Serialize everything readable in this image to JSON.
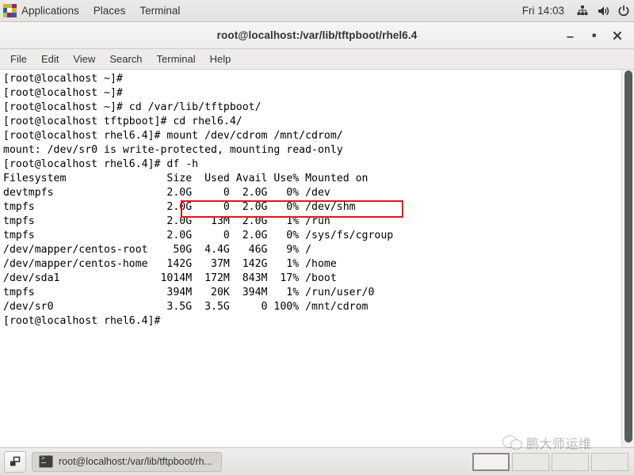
{
  "top_panel": {
    "apps_label": "Applications",
    "places_label": "Places",
    "terminal_label": "Terminal",
    "clock": "Fri 14:03",
    "icons": [
      "network-icon",
      "volume-icon",
      "power-icon"
    ],
    "logo_name": "centos-pinwheel-logo"
  },
  "window": {
    "title": "root@localhost:/var/lib/tftpboot/rhel6.4",
    "minimize_label": "–",
    "maximize_label": "▫",
    "close_label": "✕"
  },
  "menubar": {
    "items": [
      {
        "label": "File"
      },
      {
        "label": "Edit"
      },
      {
        "label": "View"
      },
      {
        "label": "Search"
      },
      {
        "label": "Terminal"
      },
      {
        "label": "Help"
      }
    ]
  },
  "terminal": {
    "lines": [
      "[root@localhost ~]#",
      "[root@localhost ~]#",
      "[root@localhost ~]# cd /var/lib/tftpboot/",
      "[root@localhost tftpboot]# cd rhel6.4/",
      "[root@localhost rhel6.4]# mount /dev/cdrom /mnt/cdrom/",
      "mount: /dev/sr0 is write-protected, mounting read-only",
      "[root@localhost rhel6.4]# df -h",
      "Filesystem                Size  Used Avail Use% Mounted on",
      "devtmpfs                  2.0G     0  2.0G   0% /dev",
      "tmpfs                     2.0G     0  2.0G   0% /dev/shm",
      "tmpfs                     2.0G   13M  2.0G   1% /run",
      "tmpfs                     2.0G     0  2.0G   0% /sys/fs/cgroup",
      "/dev/mapper/centos-root    50G  4.4G   46G   9% /",
      "/dev/mapper/centos-home   142G   37M  142G   1% /home",
      "/dev/sda1                1014M  172M  843M  17% /boot",
      "tmpfs                     394M   20K  394M   1% /run/user/0",
      "/dev/sr0                  3.5G  3.5G     0 100% /mnt/cdrom",
      "[root@localhost rhel6.4]#"
    ],
    "text": "[root@localhost ~]#\n[root@localhost ~]#\n[root@localhost ~]# cd /var/lib/tftpboot/\n[root@localhost tftpboot]# cd rhel6.4/\n[root@localhost rhel6.4]# mount /dev/cdrom /mnt/cdrom/\nmount: /dev/sr0 is write-protected, mounting read-only\n[root@localhost rhel6.4]# df -h\nFilesystem                Size  Used Avail Use% Mounted on\ndevtmpfs                  2.0G     0  2.0G   0% /dev\ntmpfs                     2.0G     0  2.0G   0% /dev/shm\ntmpfs                     2.0G   13M  2.0G   1% /run\ntmpfs                     2.0G     0  2.0G   0% /sys/fs/cgroup\n/dev/mapper/centos-root    50G  4.4G   46G   9% /\n/dev/mapper/centos-home   142G   37M  142G   1% /home\n/dev/sda1                1014M  172M  843M  17% /boot\ntmpfs                     394M   20K  394M   1% /run/user/0\n/dev/sr0                  3.5G  3.5G     0 100% /mnt/cdrom\n[root@localhost rhel6.4]#",
    "highlighted_command": "mount /dev/cdrom /mnt/cdrom/",
    "highlight_color": "#e8121a",
    "df_table": {
      "headers": [
        "Filesystem",
        "Size",
        "Used",
        "Avail",
        "Use%",
        "Mounted on"
      ],
      "rows": [
        [
          "devtmpfs",
          "2.0G",
          "0",
          "2.0G",
          "0%",
          "/dev"
        ],
        [
          "tmpfs",
          "2.0G",
          "0",
          "2.0G",
          "0%",
          "/dev/shm"
        ],
        [
          "tmpfs",
          "2.0G",
          "13M",
          "2.0G",
          "1%",
          "/run"
        ],
        [
          "tmpfs",
          "2.0G",
          "0",
          "2.0G",
          "0%",
          "/sys/fs/cgroup"
        ],
        [
          "/dev/mapper/centos-root",
          "50G",
          "4.4G",
          "46G",
          "9%",
          "/"
        ],
        [
          "/dev/mapper/centos-home",
          "142G",
          "37M",
          "142G",
          "1%",
          "/home"
        ],
        [
          "/dev/sda1",
          "1014M",
          "172M",
          "843M",
          "17%",
          "/boot"
        ],
        [
          "tmpfs",
          "394M",
          "20K",
          "394M",
          "1%",
          "/run/user/0"
        ],
        [
          "/dev/sr0",
          "3.5G",
          "3.5G",
          "0",
          "100%",
          "/mnt/cdrom"
        ]
      ]
    }
  },
  "taskbar": {
    "window_button_label": "root@localhost:/var/lib/tftpboot/rh...",
    "workspaces": [
      {
        "active": true
      },
      {
        "active": false
      },
      {
        "active": false
      },
      {
        "active": false
      }
    ]
  },
  "watermark": {
    "text": "鹏大师运维",
    "logo_name": "wechat-logo"
  }
}
